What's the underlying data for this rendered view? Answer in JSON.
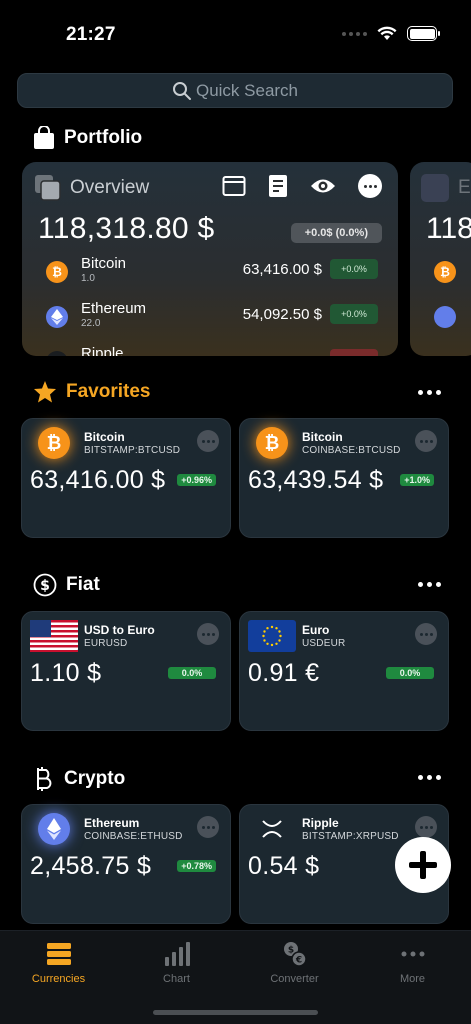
{
  "status_bar": {
    "time": "21:27"
  },
  "search": {
    "placeholder": "Quick Search"
  },
  "portfolio": {
    "title": "Portfolio",
    "card": {
      "title": "Overview",
      "total": "118,318.80 $",
      "change": "+0.0$ (0.0%)",
      "holdings": [
        {
          "name": "Bitcoin",
          "qty": "1.0",
          "value": "63,416.00 $",
          "change": "+0.0%",
          "icon": "bitcoin-icon",
          "color": "#f7931a",
          "symbol": "₿"
        },
        {
          "name": "Ethereum",
          "qty": "22.0",
          "value": "54,092.50 $",
          "change": "+0.0%",
          "icon": "ethereum-icon",
          "color": "#627eea",
          "symbol": "◆"
        },
        {
          "name": "Ripple",
          "qty": "",
          "value": "",
          "change": "",
          "icon": "ripple-icon",
          "color": "#222",
          "symbol": "✕"
        }
      ]
    },
    "peek": {
      "title": "E",
      "total": "118"
    }
  },
  "favorites": {
    "title": "Favorites",
    "tiles": [
      {
        "name": "Bitcoin",
        "symbol": "BITSTAMP:BTCUSD",
        "value": "63,416.00 $",
        "change": "+0.96%",
        "icon": "bitcoin-icon"
      },
      {
        "name": "Bitcoin",
        "symbol": "COINBASE:BTCUSD",
        "value": "63,439.54 $",
        "change": "+1.0%",
        "icon": "bitcoin-icon"
      }
    ]
  },
  "fiat": {
    "title": "Fiat",
    "tiles": [
      {
        "name": "USD to Euro",
        "symbol": "EURUSD",
        "value": "1.10 $",
        "change": "0.0%",
        "icon": "us-flag-icon"
      },
      {
        "name": "Euro",
        "symbol": "USDEUR",
        "value": "0.91 €",
        "change": "0.0%",
        "icon": "eu-flag-icon"
      }
    ]
  },
  "crypto": {
    "title": "Crypto",
    "tiles": [
      {
        "name": "Ethereum",
        "symbol": "COINBASE:ETHUSD",
        "value": "2,458.75 $",
        "change": "+0.78%",
        "icon": "ethereum-icon"
      },
      {
        "name": "Ripple",
        "symbol": "BITSTAMP:XRPUSD",
        "value": "0.54 $",
        "change": "",
        "icon": "ripple-icon"
      }
    ]
  },
  "tab_bar": {
    "items": [
      {
        "label": "Currencies",
        "icon": "stack-icon",
        "active": true
      },
      {
        "label": "Chart",
        "icon": "bar-chart-icon",
        "active": false
      },
      {
        "label": "Converter",
        "icon": "exchange-icon",
        "active": false
      },
      {
        "label": "More",
        "icon": "more-icon",
        "active": false
      }
    ]
  },
  "colors": {
    "accent": "#f5a623",
    "positive": "#1f8a3f",
    "tile_bg": "#1c2830"
  }
}
